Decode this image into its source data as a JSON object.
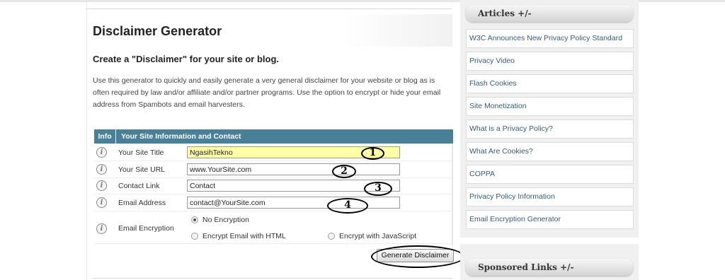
{
  "main": {
    "title": "Disclaimer Generator",
    "subtitle": "Create a \"Disclaimer\" for your site or blog.",
    "intro": "Use this generator to quickly and easily generate a very general disclaimer for your website or blog as is often required by law and/or affiliate and/or partner programs. Use the option to encrypt or hide your email address from Spambots and email harvesters."
  },
  "form": {
    "header_info": "Info",
    "header_title": "Your Site Information and Contact",
    "info_icon_glyph": "i",
    "fields": [
      {
        "label": "Your Site Title",
        "value": "NgasihTekno",
        "annotation": "1"
      },
      {
        "label": "Your Site URL",
        "value": "www.YourSite.com",
        "annotation": "2"
      },
      {
        "label": "Contact Link",
        "value": "Contact",
        "annotation": "3"
      },
      {
        "label": "Email Address",
        "value": "contact@YourSite.com",
        "annotation": "4"
      }
    ],
    "encryption": {
      "label": "Email Encryption",
      "options": [
        "No Encryption",
        "Encrypt Email with HTML",
        "Encrypt with JavaScript"
      ],
      "selected": "No Encryption"
    },
    "generate_label": "Generate Disclaimer"
  },
  "sidebar": {
    "articles_heading": "Articles +/-",
    "articles": [
      "W3C Announces New Privacy Policy Standard",
      "Privacy Video",
      "Flash Cookies",
      "Site Monetization",
      "What is a Privacy Policy?",
      "What Are Cookies?",
      "COPPA",
      "Privacy Policy Information",
      "Email Encryption Generator"
    ],
    "sponsored_heading": "Sponsored Links +/-"
  }
}
